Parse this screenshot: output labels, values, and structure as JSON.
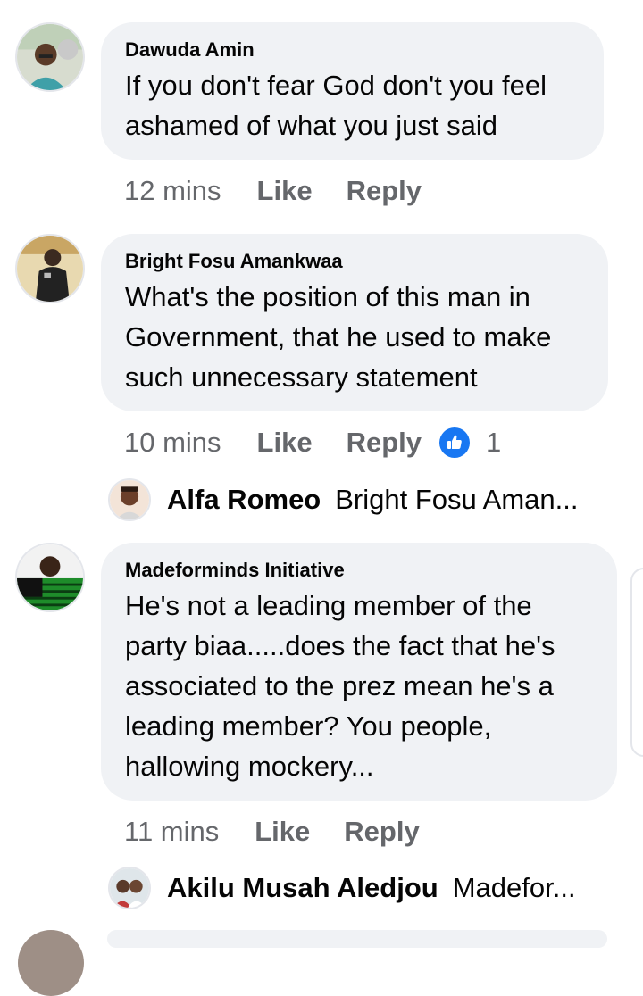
{
  "comments": [
    {
      "author": "Dawuda Amin",
      "text": "If you don't fear God don't you feel\nashamed of what you just said",
      "time": "12 mins",
      "like_label": "Like",
      "reply_label": "Reply"
    },
    {
      "author": "Bright Fosu Amankwaa",
      "text": "What's the position of this man in\nGovernment, that he used to make\nsuch unnecessary statement",
      "time": "10 mins",
      "like_label": "Like",
      "reply_label": "Reply",
      "reaction_count": "1",
      "reply_preview": {
        "author": "Alfa Romeo",
        "text": "Bright Fosu Aman..."
      }
    },
    {
      "author": "Madeforminds Initiative",
      "text": "He's not a leading member of the\nparty biaa.....does the fact that he's\nassociated to the prez mean he's a\nleading member? You people,\nhallowing mockery...",
      "time": "11 mins",
      "like_label": "Like",
      "reply_label": "Reply",
      "reply_preview": {
        "author": "Akilu Musah Aledjou",
        "text": "Madefor..."
      }
    }
  ],
  "colors": {
    "bubble": "#f0f2f5",
    "meta_text": "#65676b",
    "like_badge": "#1877f2"
  }
}
